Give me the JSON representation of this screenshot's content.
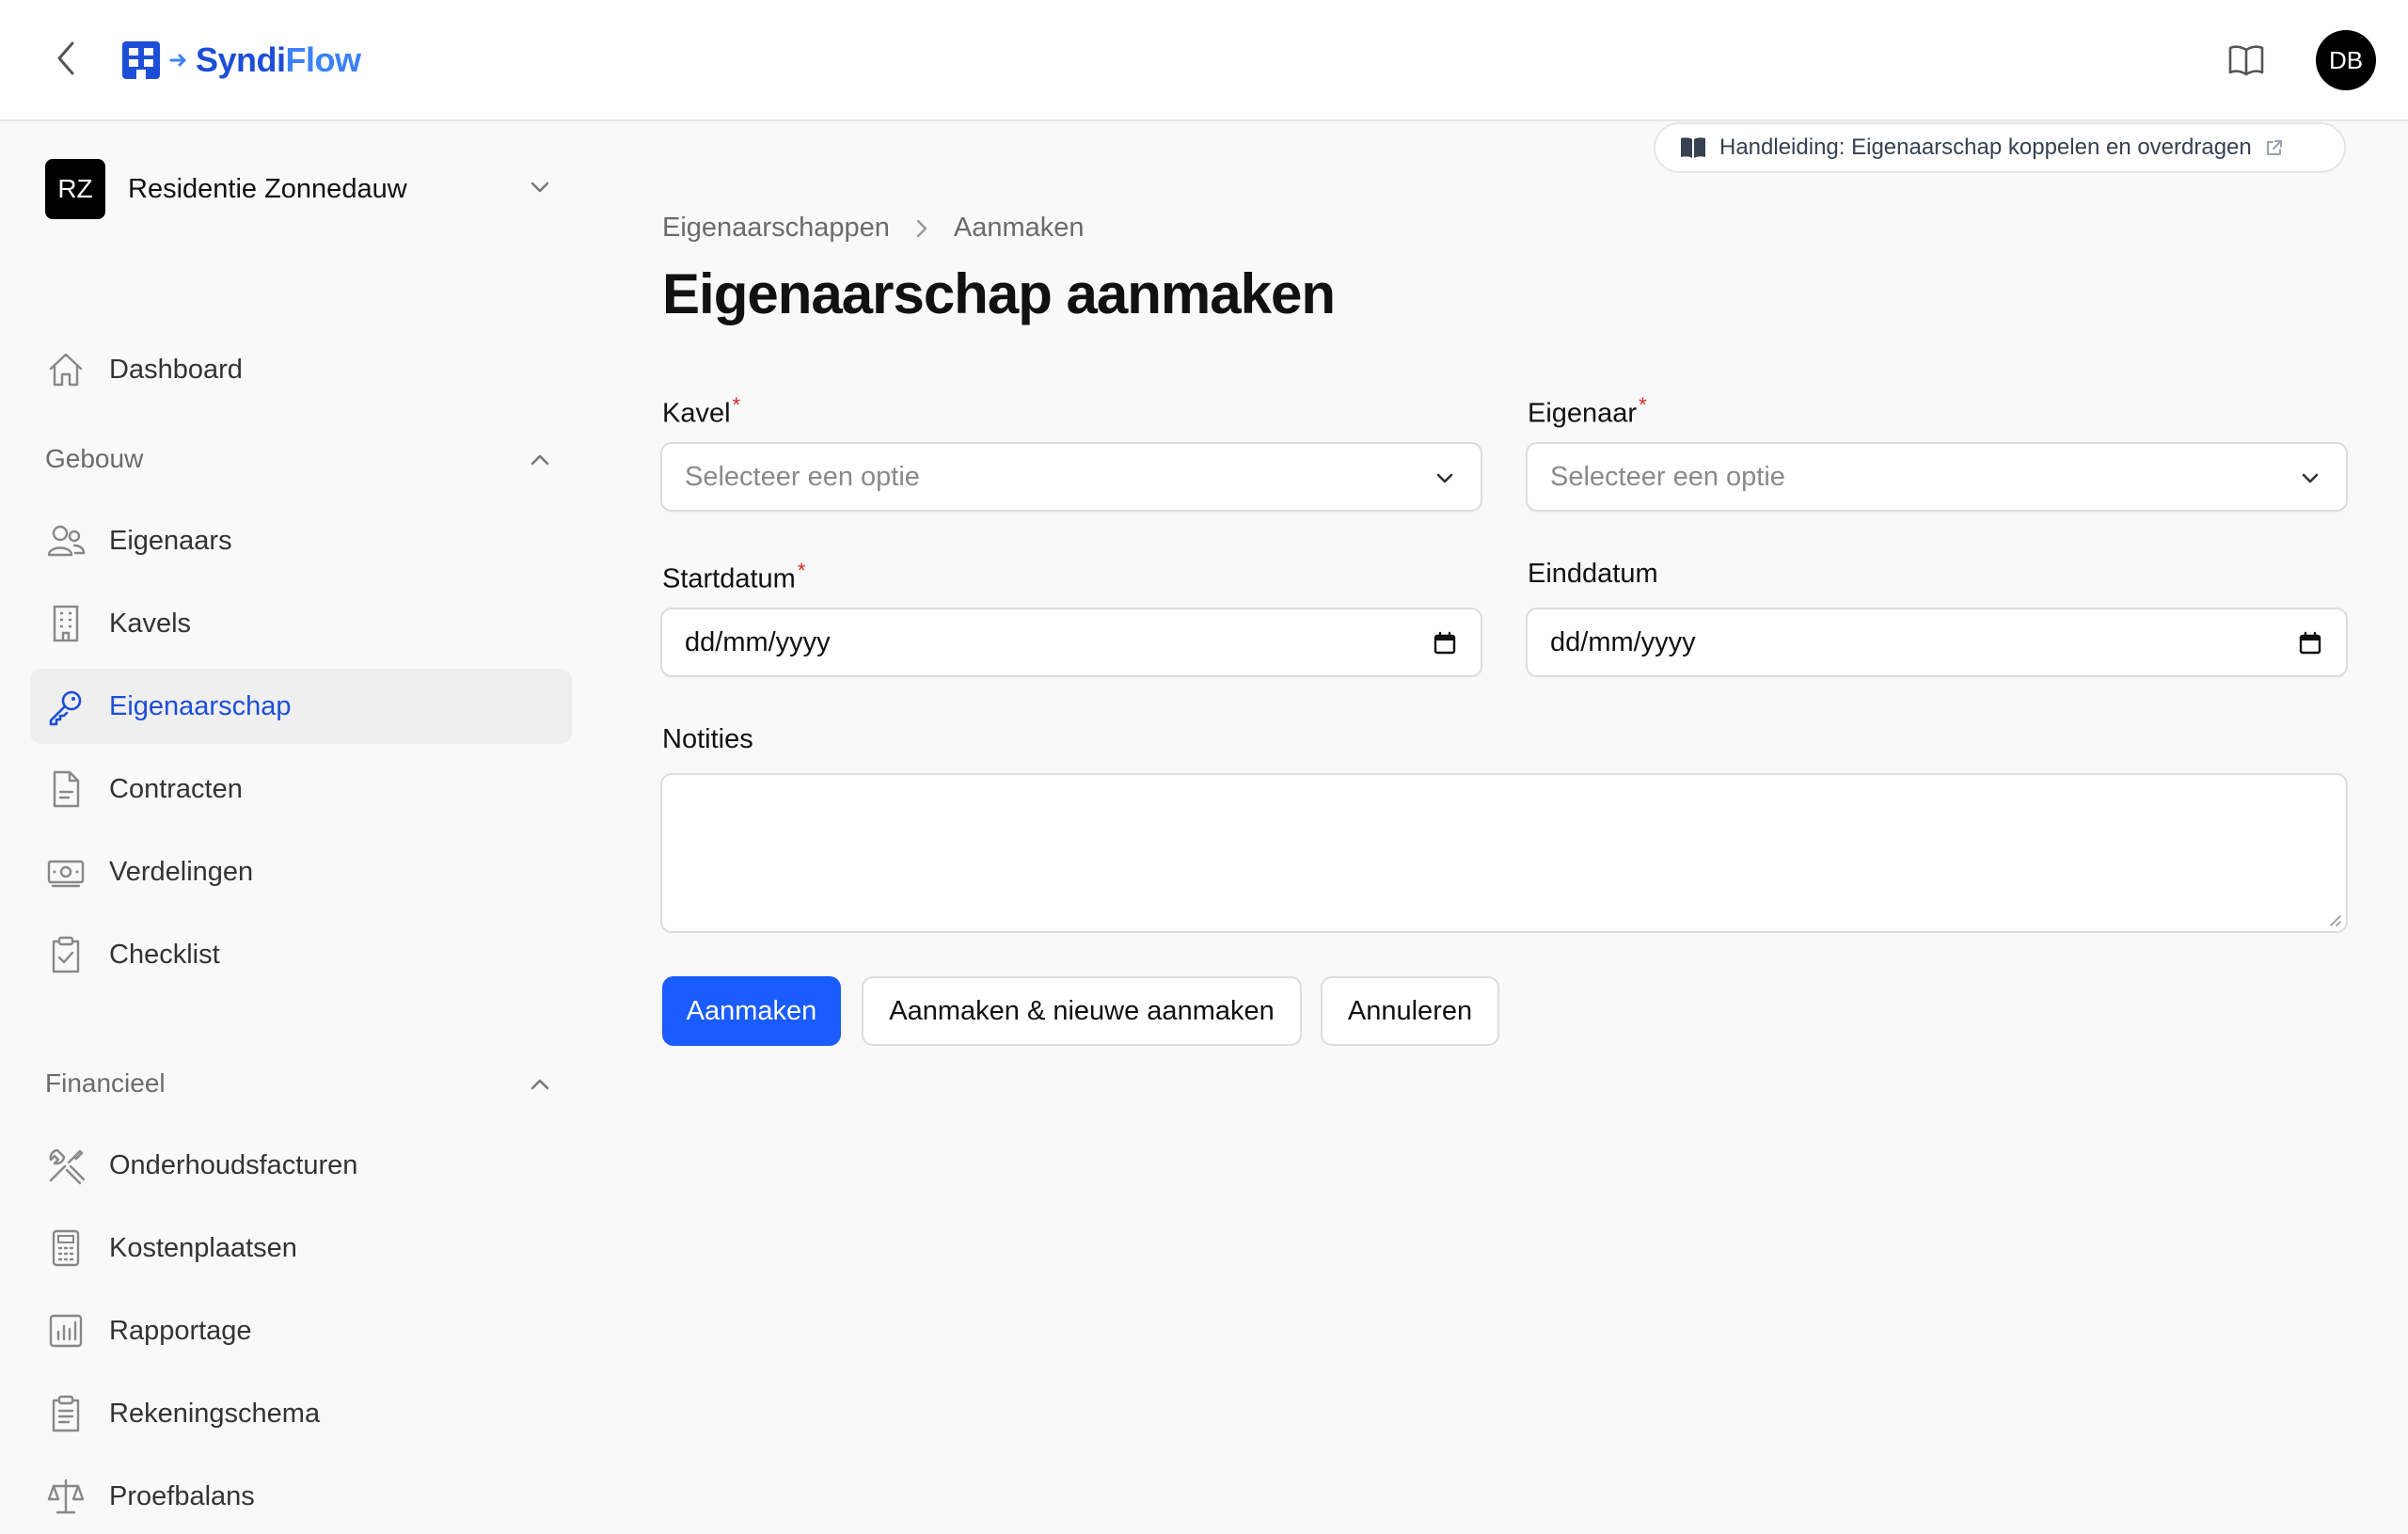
{
  "header": {
    "logo_text_a": "Syndi",
    "logo_text_b": "Flow",
    "avatar_initials": "DB"
  },
  "sidebar": {
    "tenant": {
      "initials": "RZ",
      "name": "Residentie Zonnedauw"
    },
    "dashboard_label": "Dashboard",
    "groups": {
      "gebouw": {
        "label": "Gebouw",
        "items": [
          "Eigenaars",
          "Kavels",
          "Eigenaarschap",
          "Contracten",
          "Verdelingen",
          "Checklist"
        ]
      },
      "financieel": {
        "label": "Financieel",
        "items": [
          "Onderhoudsfacturen",
          "Kostenplaatsen",
          "Rapportage",
          "Rekeningschema",
          "Proefbalans"
        ]
      }
    },
    "active_item": "Eigenaarschap"
  },
  "main": {
    "guide_link": "Handleiding: Eigenaarschap koppelen en overdragen",
    "breadcrumb": [
      "Eigenaarschappen",
      "Aanmaken"
    ],
    "title": "Eigenaarschap aanmaken",
    "form": {
      "kavel": {
        "label": "Kavel",
        "required": true,
        "placeholder": "Selecteer een optie"
      },
      "eigenaar": {
        "label": "Eigenaar",
        "required": true,
        "placeholder": "Selecteer een optie"
      },
      "startdatum": {
        "label": "Startdatum",
        "required": true,
        "value": "dd/mm/yyyy"
      },
      "einddatum": {
        "label": "Einddatum",
        "required": false,
        "value": "dd/mm/yyyy"
      },
      "notities": {
        "label": "Notities",
        "value": ""
      },
      "required_mark": "*"
    },
    "buttons": {
      "create": "Aanmaken",
      "create_new": "Aanmaken & nieuwe aanmaken",
      "cancel": "Annuleren"
    }
  },
  "colors": {
    "primary": "#1a5cff",
    "accent_blue": "#1d4ed8",
    "required": "#dc2626"
  }
}
